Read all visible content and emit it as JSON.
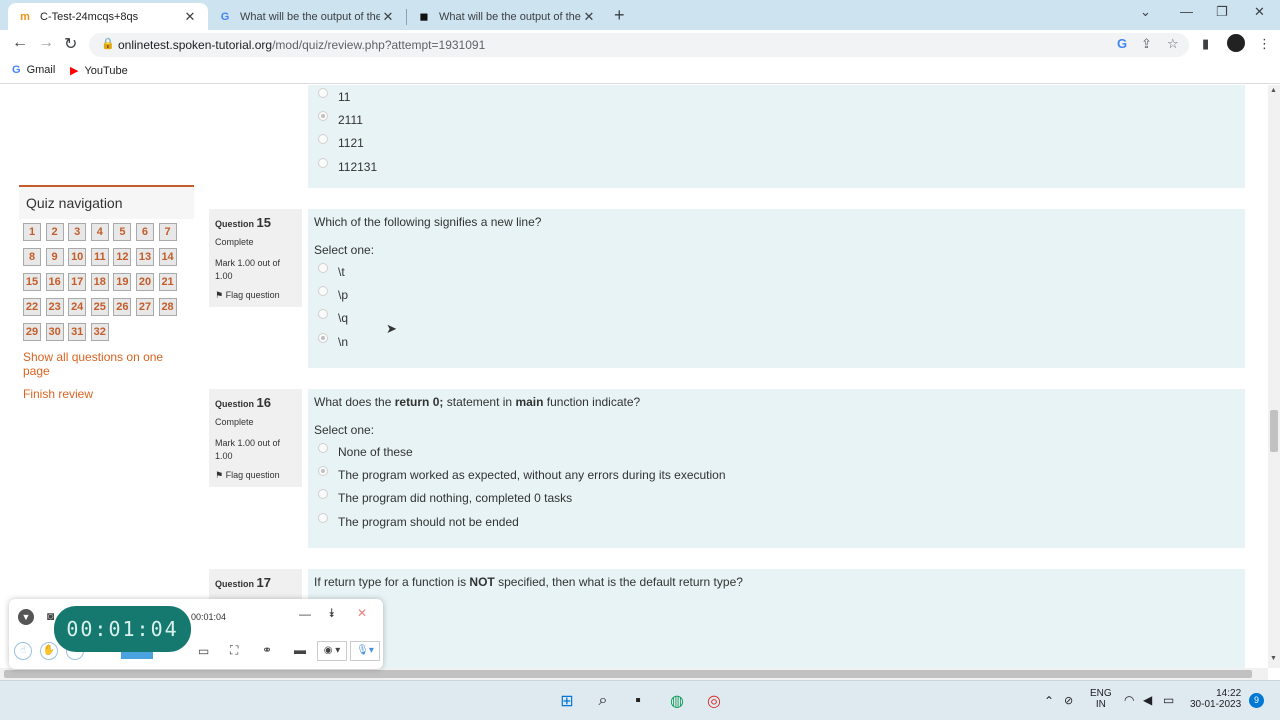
{
  "browser": {
    "tabs": [
      {
        "title": "C-Test-24mcqs+8qs",
        "icon": "moodle-icon",
        "active": true
      },
      {
        "title": "What will be the output of the p",
        "icon": "google-icon",
        "active": false
      },
      {
        "title": "What will be the output of the fo",
        "icon": "bookmark-icon",
        "active": false
      }
    ],
    "url_domain": "onlinetest.spoken-tutorial.org",
    "url_path": "/mod/quiz/review.php?attempt=1931091",
    "bookmarks": [
      {
        "label": "Gmail",
        "icon": "google-icon"
      },
      {
        "label": "YouTube",
        "icon": "youtube-icon"
      }
    ]
  },
  "quiz_nav": {
    "title": "Quiz navigation",
    "numbers": [
      "1",
      "2",
      "3",
      "4",
      "5",
      "6",
      "7",
      "8",
      "9",
      "10",
      "11",
      "12",
      "13",
      "14",
      "15",
      "16",
      "17",
      "18",
      "19",
      "20",
      "21",
      "22",
      "23",
      "24",
      "25",
      "26",
      "27",
      "28",
      "29",
      "30",
      "31",
      "32"
    ],
    "show_all": "Show all questions on one page",
    "finish": "Finish review"
  },
  "prev_question": {
    "options": [
      "11",
      "2111",
      "1121",
      "112131"
    ],
    "selected": 1
  },
  "questions": [
    {
      "label": "Question",
      "number": "15",
      "state": "Complete",
      "mark": "Mark 1.00 out of 1.00",
      "flag": "Flag question",
      "text": "Which of the following signifies a new line?",
      "select_label": "Select one:",
      "options": [
        "\\t",
        "\\p",
        "\\q",
        "\\n"
      ],
      "selected": 3
    },
    {
      "label": "Question",
      "number": "16",
      "state": "Complete",
      "mark": "Mark 1.00 out of 1.00",
      "flag": "Flag question",
      "text_parts": [
        "What does the ",
        "return 0;",
        " statement in ",
        "main",
        " function indicate?"
      ],
      "select_label": "Select one:",
      "options": [
        "None of these",
        "The program worked as expected, without any errors during its execution",
        "The program did nothing, completed 0 tasks",
        "The program should not be ended"
      ],
      "selected": 1
    },
    {
      "label": "Question",
      "number": "17",
      "text_parts": [
        "If return type for a function is ",
        "NOT",
        " specified, then what is the default return type?"
      ]
    }
  ],
  "recorder": {
    "timer": "00:01:04",
    "small_timer": "00:01:04"
  },
  "taskbar": {
    "lang1": "ENG",
    "lang2": "IN",
    "time": "14:22",
    "date": "30-01-2023",
    "notif_count": "9"
  }
}
